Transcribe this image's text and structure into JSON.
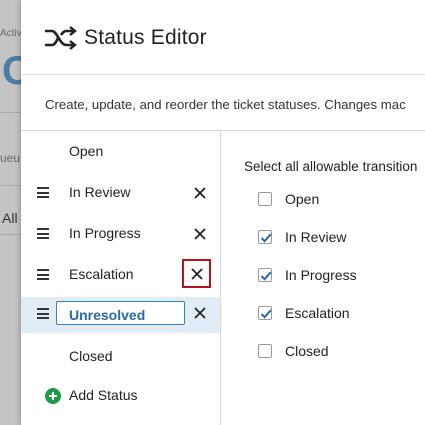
{
  "background": {
    "fragments": [
      "Activ",
      "C",
      "ueu",
      "All"
    ]
  },
  "modal": {
    "title": "Status Editor",
    "title_icon": "shuffle-icon",
    "description": "Create, update, and reorder the ticket statuses. Changes mac"
  },
  "statuses": [
    {
      "label": "Open",
      "draggable": false,
      "removable": false
    },
    {
      "label": "In Review",
      "draggable": true,
      "removable": true
    },
    {
      "label": "In Progress",
      "draggable": true,
      "removable": true
    },
    {
      "label": "Escalation",
      "draggable": true,
      "removable": true,
      "highlighted": true
    },
    {
      "label": "Unresolved",
      "draggable": true,
      "removable": true,
      "editing": true
    },
    {
      "label": "Closed",
      "draggable": false,
      "removable": false
    }
  ],
  "add_status_label": "Add Status",
  "transitions": {
    "title": "Select all allowable transition",
    "options": [
      {
        "label": "Open",
        "checked": false
      },
      {
        "label": "In Review",
        "checked": true
      },
      {
        "label": "In Progress",
        "checked": true
      },
      {
        "label": "Escalation",
        "checked": true
      },
      {
        "label": "Closed",
        "checked": false
      }
    ]
  },
  "colors": {
    "accent": "#2a6aa8",
    "selected_row": "#e1ecf6",
    "highlight_border": "#b5121b",
    "add_icon": "#1f9a4a"
  }
}
